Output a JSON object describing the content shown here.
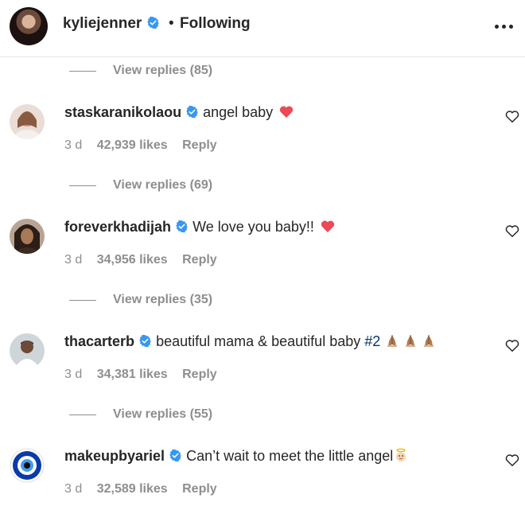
{
  "header": {
    "username": "kyliejenner",
    "separator": "•",
    "follow_status": "Following"
  },
  "view_replies": [
    "View replies (85)",
    "View replies (69)",
    "View replies (35)",
    "View replies (55)"
  ],
  "comments": [
    {
      "username": "staskaranikolaou",
      "text": "angel baby",
      "time": "3 d",
      "likes": "42,939 likes",
      "reply": "Reply"
    },
    {
      "username": "foreverkhadijah",
      "text": "We love you baby!!",
      "time": "3 d",
      "likes": "34,956 likes",
      "reply": "Reply"
    },
    {
      "username": "thacarterb",
      "text": "beautiful mama & beautiful baby",
      "hashtag": "#2",
      "time": "3 d",
      "likes": "34,381 likes",
      "reply": "Reply"
    },
    {
      "username": "makeupbyariel",
      "text": "Can’t wait to meet the little angel",
      "time": "3 d",
      "likes": "32,589 likes",
      "reply": "Reply"
    }
  ],
  "colors": {
    "verified": "#3897f0",
    "heart": "#ed4956",
    "muted_text": "#8e8e8e",
    "hashtag": "#00376b"
  }
}
